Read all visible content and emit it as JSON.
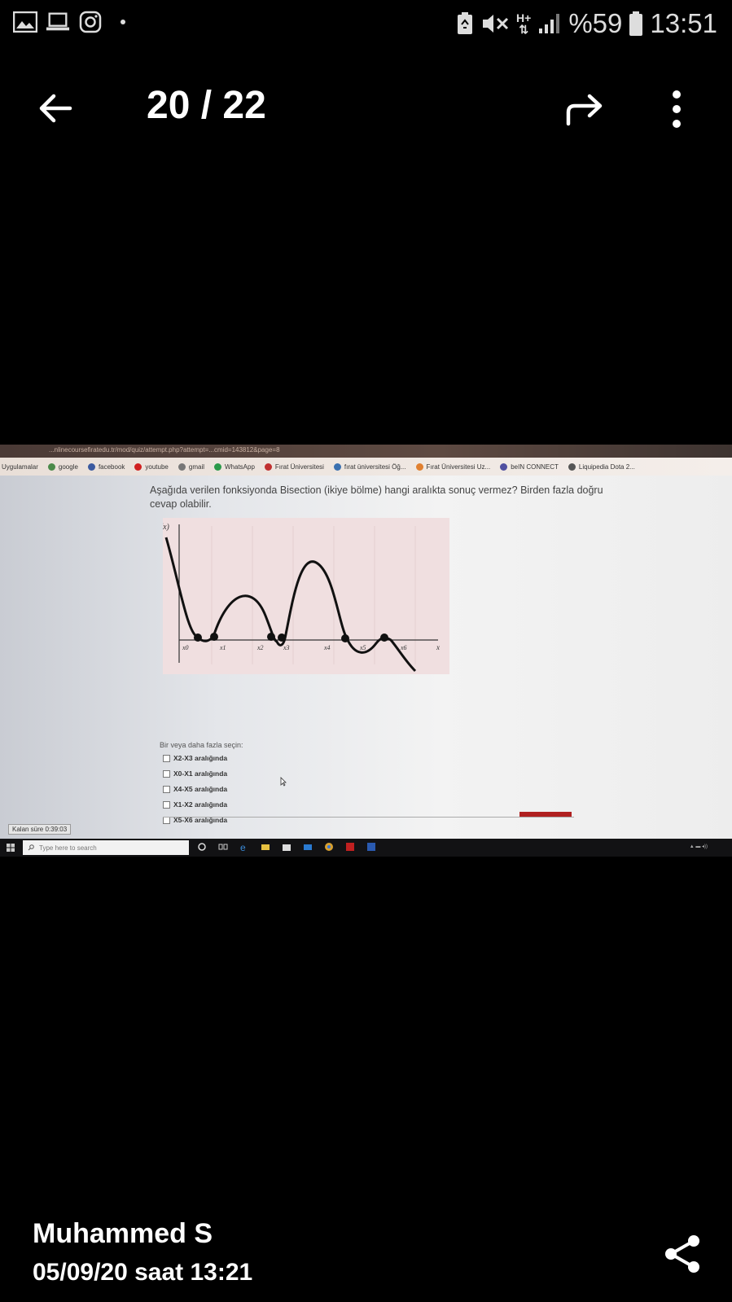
{
  "status_bar": {
    "battery_percent": "%59",
    "time": "13:51",
    "network": "H+"
  },
  "toolbar": {
    "page_counter": "20 / 22"
  },
  "photo": {
    "url_text": "...nlinecoursefiratedu.tr/mod/quiz/attempt.php?attempt=...cmid=143812&page=8",
    "bookmarks": [
      "Uygulamalar",
      "google",
      "facebook",
      "youtube",
      "gmail",
      "WhatsApp",
      "Fırat Üniversitesi",
      "fırat üniversitesi Öğ...",
      "Fırat Üniversitesi Uz...",
      "beIN CONNECT",
      "Liquipedia Dota 2..."
    ],
    "question": "Aşağıda verilen fonksiyonda Bisection (ikiye bölme) hangi aralıkta sonuç vermez? Birden fazla doğru cevap olabilir.",
    "graph": {
      "y_label": "f(x)",
      "x_label": "x",
      "points": [
        "x0",
        "x1",
        "x2",
        "x3",
        "x4",
        "x5",
        "x6"
      ]
    },
    "choices_label": "Bir veya daha fazla seçin:",
    "choices": [
      "X2-X3 aralığında",
      "X0-X1 aralığında",
      "X4-X5 aralığında",
      "X1-X2 aralığında",
      "X5-X6 aralığında"
    ],
    "timer": "Kalan süre 0:39:03",
    "taskbar_search": "Type here to search"
  },
  "footer": {
    "author": "Muhammed S",
    "datetime": "05/09/20 saat 13:21"
  },
  "colors": {
    "background": "#000000",
    "text": "#ffffff",
    "graph_bg": "#f0dfe0"
  }
}
